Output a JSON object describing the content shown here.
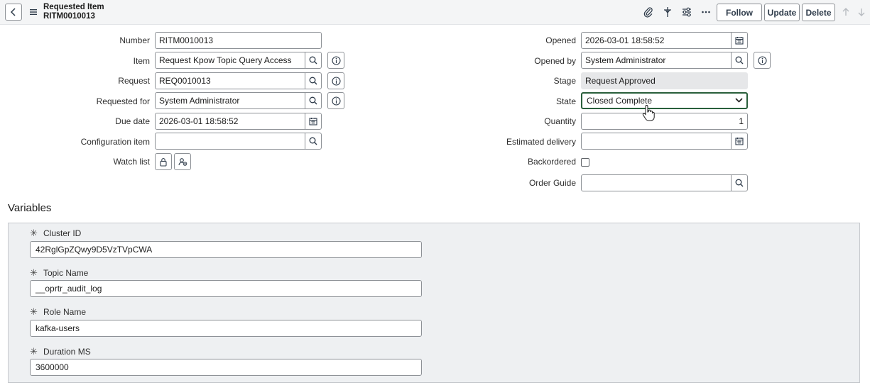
{
  "header": {
    "title_line1": "Requested Item",
    "title_line2": "RITM0010013",
    "buttons": {
      "follow": "Follow",
      "update": "Update",
      "delete": "Delete"
    }
  },
  "form": {
    "left": {
      "number": {
        "label": "Number",
        "value": "RITM0010013"
      },
      "item": {
        "label": "Item",
        "value": "Request Kpow Topic Query Access"
      },
      "request": {
        "label": "Request",
        "value": "REQ0010013"
      },
      "requested_for": {
        "label": "Requested for",
        "value": "System Administrator"
      },
      "due_date": {
        "label": "Due date",
        "value": "2026-03-01 18:58:52"
      },
      "configuration_item": {
        "label": "Configuration item",
        "value": ""
      },
      "watch_list": {
        "label": "Watch list"
      }
    },
    "right": {
      "opened": {
        "label": "Opened",
        "value": "2026-03-01 18:58:52"
      },
      "opened_by": {
        "label": "Opened by",
        "value": "System Administrator"
      },
      "stage": {
        "label": "Stage",
        "value": "Request Approved"
      },
      "state": {
        "label": "State",
        "value": "Closed Complete"
      },
      "quantity": {
        "label": "Quantity",
        "value": "1"
      },
      "estimated_delivery": {
        "label": "Estimated delivery",
        "value": ""
      },
      "backordered": {
        "label": "Backordered",
        "checked": false
      },
      "order_guide": {
        "label": "Order Guide",
        "value": ""
      }
    }
  },
  "variables": {
    "title": "Variables",
    "items": [
      {
        "label": "Cluster ID",
        "value": "42RglGpZQwy9D5VzTVpCWA"
      },
      {
        "label": "Topic Name",
        "value": "__oprtr_audit_log"
      },
      {
        "label": "Role Name",
        "value": "kafka-users"
      },
      {
        "label": "Duration MS",
        "value": "3600000"
      }
    ]
  },
  "colors": {
    "accent": "#295f3b",
    "header_bg": "#f4f5f6",
    "variables_bg": "#eef0f2"
  }
}
